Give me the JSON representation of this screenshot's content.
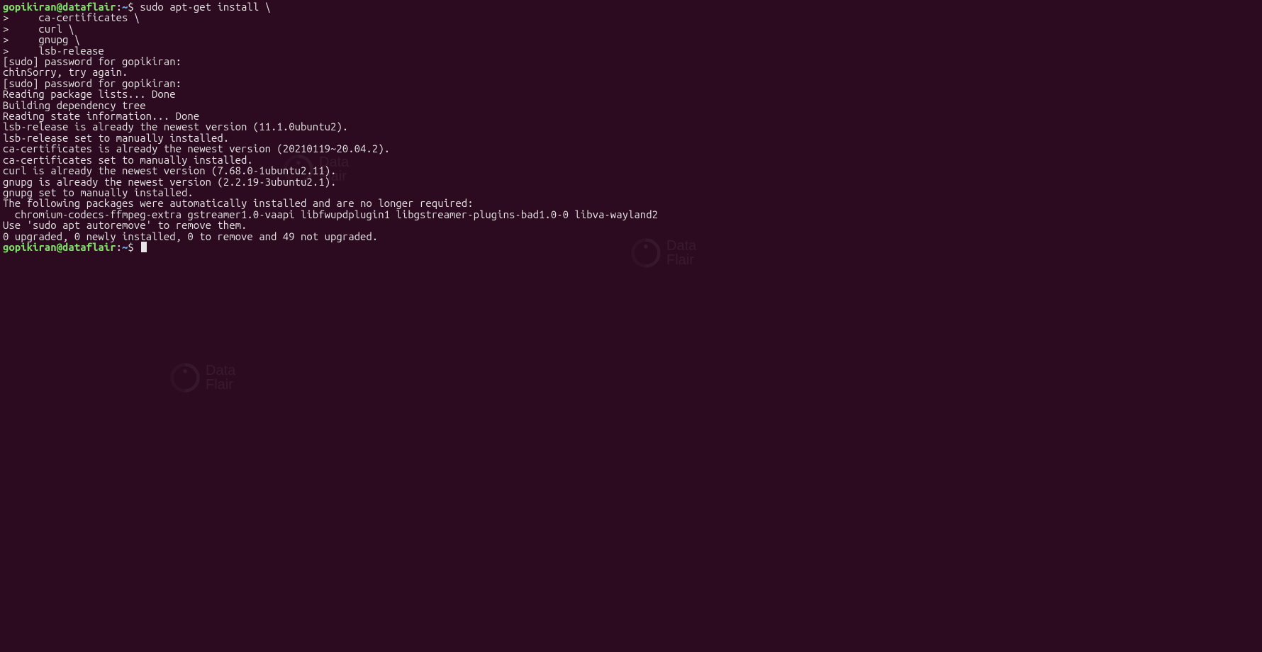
{
  "prompt": {
    "user_host": "gopikiran@dataflair",
    "separator": ":",
    "path": "~",
    "symbol": "$"
  },
  "lines": [
    {
      "type": "prompt_cmd",
      "cmd": "sudo apt-get install \\"
    },
    {
      "type": "out",
      "text": ">     ca-certificates \\"
    },
    {
      "type": "out",
      "text": ">     curl \\"
    },
    {
      "type": "out",
      "text": ">     gnupg \\"
    },
    {
      "type": "out",
      "text": ">     lsb-release"
    },
    {
      "type": "out",
      "text": "[sudo] password for gopikiran:"
    },
    {
      "type": "out",
      "text": "chinSorry, try again."
    },
    {
      "type": "out",
      "text": "[sudo] password for gopikiran:"
    },
    {
      "type": "out",
      "text": "Reading package lists... Done"
    },
    {
      "type": "out",
      "text": "Building dependency tree"
    },
    {
      "type": "out",
      "text": "Reading state information... Done"
    },
    {
      "type": "out",
      "text": "lsb-release is already the newest version (11.1.0ubuntu2)."
    },
    {
      "type": "out",
      "text": "lsb-release set to manually installed."
    },
    {
      "type": "out",
      "text": "ca-certificates is already the newest version (20210119~20.04.2)."
    },
    {
      "type": "out",
      "text": "ca-certificates set to manually installed."
    },
    {
      "type": "out",
      "text": "curl is already the newest version (7.68.0-1ubuntu2.11)."
    },
    {
      "type": "out",
      "text": "gnupg is already the newest version (2.2.19-3ubuntu2.1)."
    },
    {
      "type": "out",
      "text": "gnupg set to manually installed."
    },
    {
      "type": "out",
      "text": "The following packages were automatically installed and are no longer required:"
    },
    {
      "type": "out",
      "text": "  chromium-codecs-ffmpeg-extra gstreamer1.0-vaapi libfwupdplugin1 libgstreamer-plugins-bad1.0-0 libva-wayland2"
    },
    {
      "type": "out",
      "text": "Use 'sudo apt autoremove' to remove them."
    },
    {
      "type": "out",
      "text": "0 upgraded, 0 newly installed, 0 to remove and 49 not upgraded."
    },
    {
      "type": "prompt_idle"
    }
  ],
  "watermark": {
    "top": "Data",
    "bottom": "Flair"
  }
}
